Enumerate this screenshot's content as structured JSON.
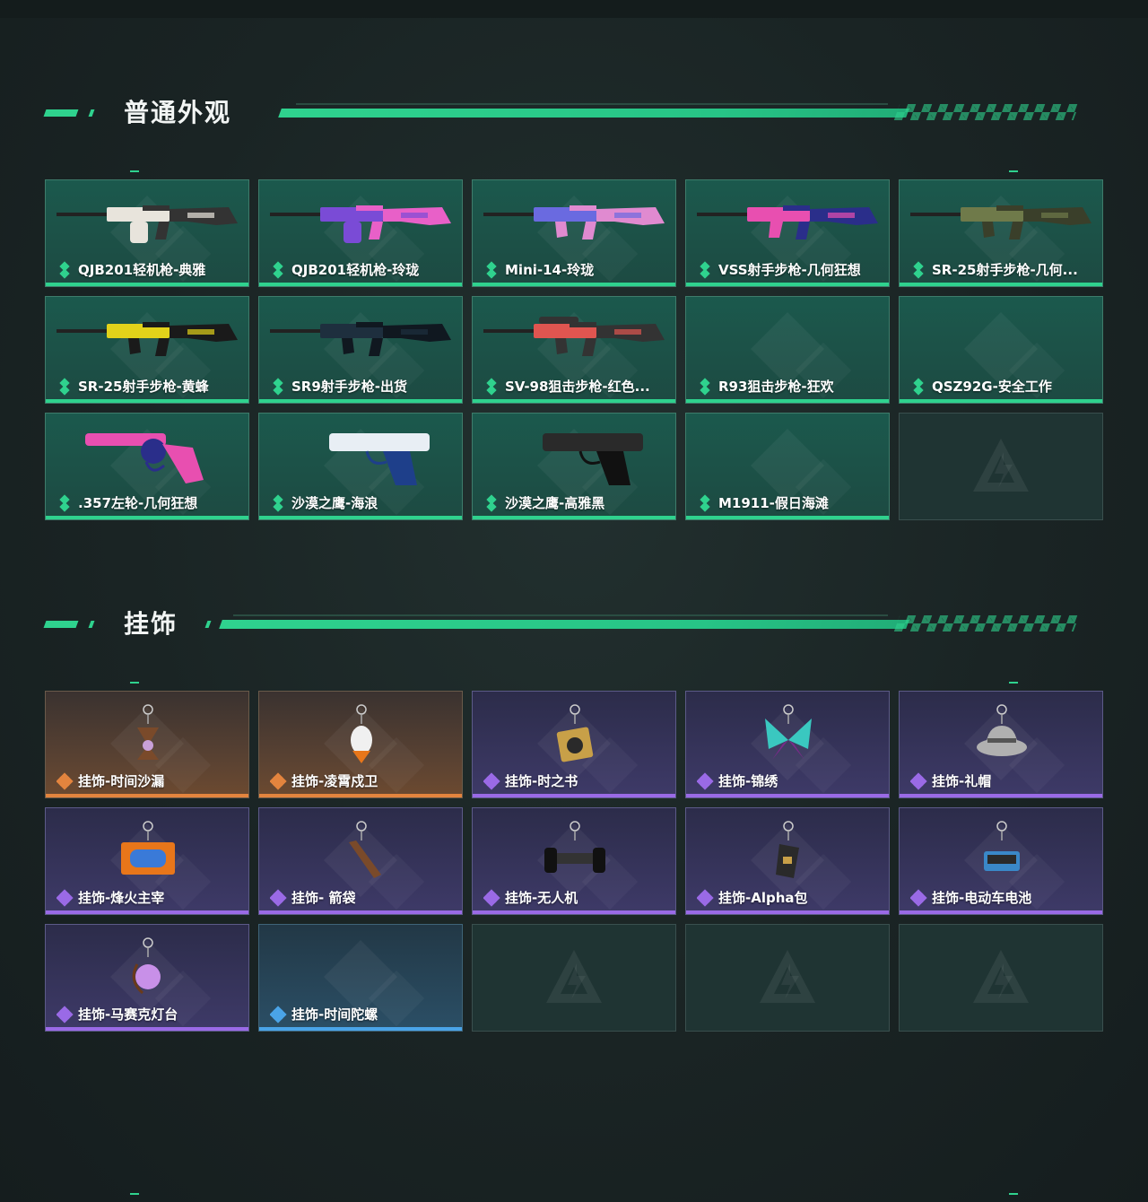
{
  "colors": {
    "accent": "#2fd28e",
    "rarity_green": "#2fd28e",
    "rarity_orange": "#e3843e",
    "rarity_purple": "#9a6ae6",
    "rarity_blue": "#4aa4e8"
  },
  "sections": [
    {
      "title": "普通外观",
      "items": [
        {
          "label": "QJB201轻机枪-典雅",
          "rarity": "green",
          "art": "lmg-icon",
          "palette": [
            "#e8e4dc",
            "#333333"
          ]
        },
        {
          "label": "QJB201轻机枪-玲珑",
          "rarity": "green",
          "art": "lmg-icon",
          "palette": [
            "#7a4bd6",
            "#e860c8"
          ]
        },
        {
          "label": "Mini-14-玲珑",
          "rarity": "green",
          "art": "rifle-icon",
          "palette": [
            "#6a6ae0",
            "#e08ad0"
          ]
        },
        {
          "label": "VSS射手步枪-几何狂想",
          "rarity": "green",
          "art": "dmr-icon",
          "palette": [
            "#e84fb0",
            "#2a2e8a"
          ]
        },
        {
          "label": "SR-25射手步枪-几何...",
          "rarity": "green",
          "art": "rifle-icon",
          "palette": [
            "#6f7a4a",
            "#3a3f2a"
          ]
        },
        {
          "label": "SR-25射手步枪-黄蜂",
          "rarity": "green",
          "art": "rifle-icon",
          "palette": [
            "#e2d21a",
            "#1a1a1a"
          ]
        },
        {
          "label": "SR9射手步枪-出货",
          "rarity": "green",
          "art": "rifle-icon",
          "palette": [
            "#1e2f3e",
            "#101820"
          ]
        },
        {
          "label": "SV-98狙击步枪-红色...",
          "rarity": "green",
          "art": "sniper-icon",
          "palette": [
            "#e05550",
            "#333333"
          ]
        },
        {
          "label": "R93狙击步枪-狂欢",
          "rarity": "green",
          "art": "",
          "palette": []
        },
        {
          "label": "QSZ92G-安全工作",
          "rarity": "green",
          "art": "",
          "palette": []
        },
        {
          "label": ".357左轮-几何狂想",
          "rarity": "green",
          "art": "revolver-icon",
          "palette": [
            "#e84fb0",
            "#2a2e8a"
          ]
        },
        {
          "label": "沙漠之鹰-海浪",
          "rarity": "green",
          "art": "pistol-icon",
          "palette": [
            "#e8eef4",
            "#1e3f8a"
          ]
        },
        {
          "label": "沙漠之鹰-高雅黑",
          "rarity": "green",
          "art": "pistol-icon",
          "palette": [
            "#2a2a2a",
            "#111111"
          ]
        },
        {
          "label": "M1911-假日海滩",
          "rarity": "green",
          "art": "",
          "palette": []
        },
        {
          "label": "",
          "rarity": "empty",
          "art": "",
          "palette": []
        }
      ]
    },
    {
      "title": "挂饰",
      "items": [
        {
          "label": "挂饰-时间沙漏",
          "rarity": "orange",
          "art": "charm-hourglass-icon",
          "palette": [
            "#c8a0d8",
            "#7a4a2a"
          ]
        },
        {
          "label": "挂饰-凌霄戍卫",
          "rarity": "orange",
          "art": "charm-eagle-icon",
          "palette": [
            "#f0f0f0",
            "#e8761a"
          ]
        },
        {
          "label": "挂饰-时之书",
          "rarity": "purple",
          "art": "charm-book-icon",
          "palette": [
            "#c8a048",
            "#2a2a2a"
          ]
        },
        {
          "label": "挂饰-锦绣",
          "rarity": "purple",
          "art": "charm-butterfly-icon",
          "palette": [
            "#3ac8c0",
            "#7a2a8a"
          ]
        },
        {
          "label": "挂饰-礼帽",
          "rarity": "purple",
          "art": "charm-hat-icon",
          "palette": [
            "#b0b0b0",
            "#555555"
          ]
        },
        {
          "label": "挂饰-烽火主宰",
          "rarity": "purple",
          "art": "charm-container-icon",
          "palette": [
            "#e8761a",
            "#3a7ad8"
          ]
        },
        {
          "label": "挂饰- 箭袋",
          "rarity": "purple",
          "art": "charm-quiver-icon",
          "palette": [
            "#7a4a2a",
            "#3a2a1a"
          ]
        },
        {
          "label": "挂饰-无人机",
          "rarity": "purple",
          "art": "charm-drone-icon",
          "palette": [
            "#333333",
            "#111111"
          ]
        },
        {
          "label": "挂饰-Alpha包",
          "rarity": "purple",
          "art": "charm-bag-icon",
          "palette": [
            "#2a2a2a",
            "#c8a048"
          ]
        },
        {
          "label": "挂饰-电动车电池",
          "rarity": "purple",
          "art": "charm-battery-icon",
          "palette": [
            "#3a88c8",
            "#2a2a2a"
          ]
        },
        {
          "label": "挂饰-马赛克灯台",
          "rarity": "purple",
          "art": "charm-lamp-icon",
          "palette": [
            "#c890e8",
            "#6a3a1a"
          ]
        },
        {
          "label": "挂饰-时间陀螺",
          "rarity": "blue",
          "art": "",
          "palette": []
        },
        {
          "label": "",
          "rarity": "empty",
          "art": "",
          "palette": []
        },
        {
          "label": "",
          "rarity": "empty",
          "art": "",
          "palette": []
        },
        {
          "label": "",
          "rarity": "empty",
          "art": "",
          "palette": []
        }
      ]
    }
  ]
}
